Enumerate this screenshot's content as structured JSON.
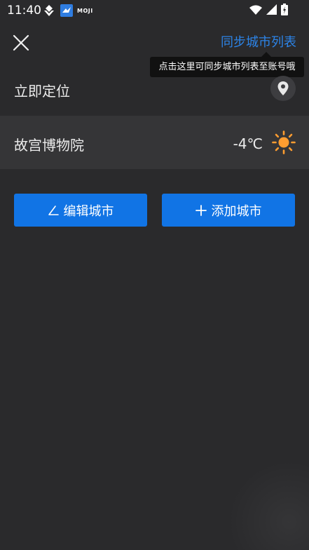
{
  "status_bar": {
    "time": "11:40",
    "notification_label": "MOJI"
  },
  "header": {
    "sync_link": "同步城市列表"
  },
  "tooltip": {
    "text": "点击这里可同步城市列表至账号哦"
  },
  "locate_row": {
    "label": "立即定位"
  },
  "cities": [
    {
      "name": "故宫博物院",
      "temperature": "-4℃",
      "weather_icon": "sun-icon"
    }
  ],
  "buttons": {
    "edit": "编辑城市",
    "add": "添加城市"
  },
  "colors": {
    "accent": "#1174e5",
    "link": "#2c84e8",
    "sun": "#ff9d30",
    "background": "#2a2a2c"
  }
}
